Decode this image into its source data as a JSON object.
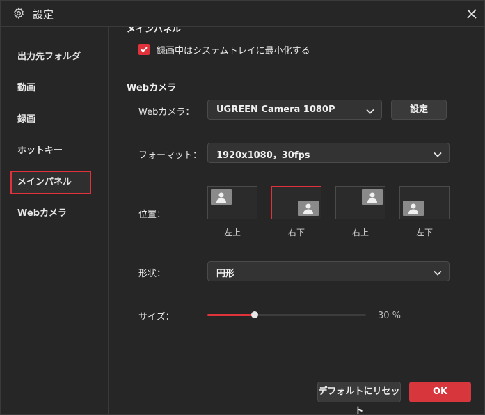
{
  "window": {
    "title": "設定",
    "icons": {
      "settings": "gear-icon",
      "close": "close-icon"
    }
  },
  "sidebar": {
    "items": [
      {
        "label": "出力先フォルダ",
        "active": false
      },
      {
        "label": "動画",
        "active": false
      },
      {
        "label": "録画",
        "active": false
      },
      {
        "label": "ホットキー",
        "active": false
      },
      {
        "label": "メインパネル",
        "active": true
      },
      {
        "label": "Webカメラ",
        "active": false
      }
    ]
  },
  "main_panel": {
    "title": "メインパネル",
    "minimize_checkbox": {
      "label": "録画中はシステムトレイに最小化する",
      "checked": true
    }
  },
  "webcam": {
    "title": "Webカメラ",
    "camera": {
      "label": "Webカメラ：",
      "value": "UGREEN Camera 1080P",
      "settings_button": "設定"
    },
    "format": {
      "label": "フォーマット：",
      "value": "1920x1080，30fps"
    },
    "position": {
      "label": "位置：",
      "options": [
        {
          "label": "左上",
          "selected": false
        },
        {
          "label": "右下",
          "selected": true
        },
        {
          "label": "右上",
          "selected": false
        },
        {
          "label": "左下",
          "selected": false
        }
      ]
    },
    "shape": {
      "label": "形状：",
      "value": "円形"
    },
    "size": {
      "label": "サイズ：",
      "value_text": "30 %",
      "percent": 30
    }
  },
  "footer": {
    "reset_button": "デフォルトにリセット",
    "ok_button": "OK"
  },
  "colors": {
    "accent": "#e0323a",
    "background": "#262626",
    "control_bg": "#333333"
  }
}
